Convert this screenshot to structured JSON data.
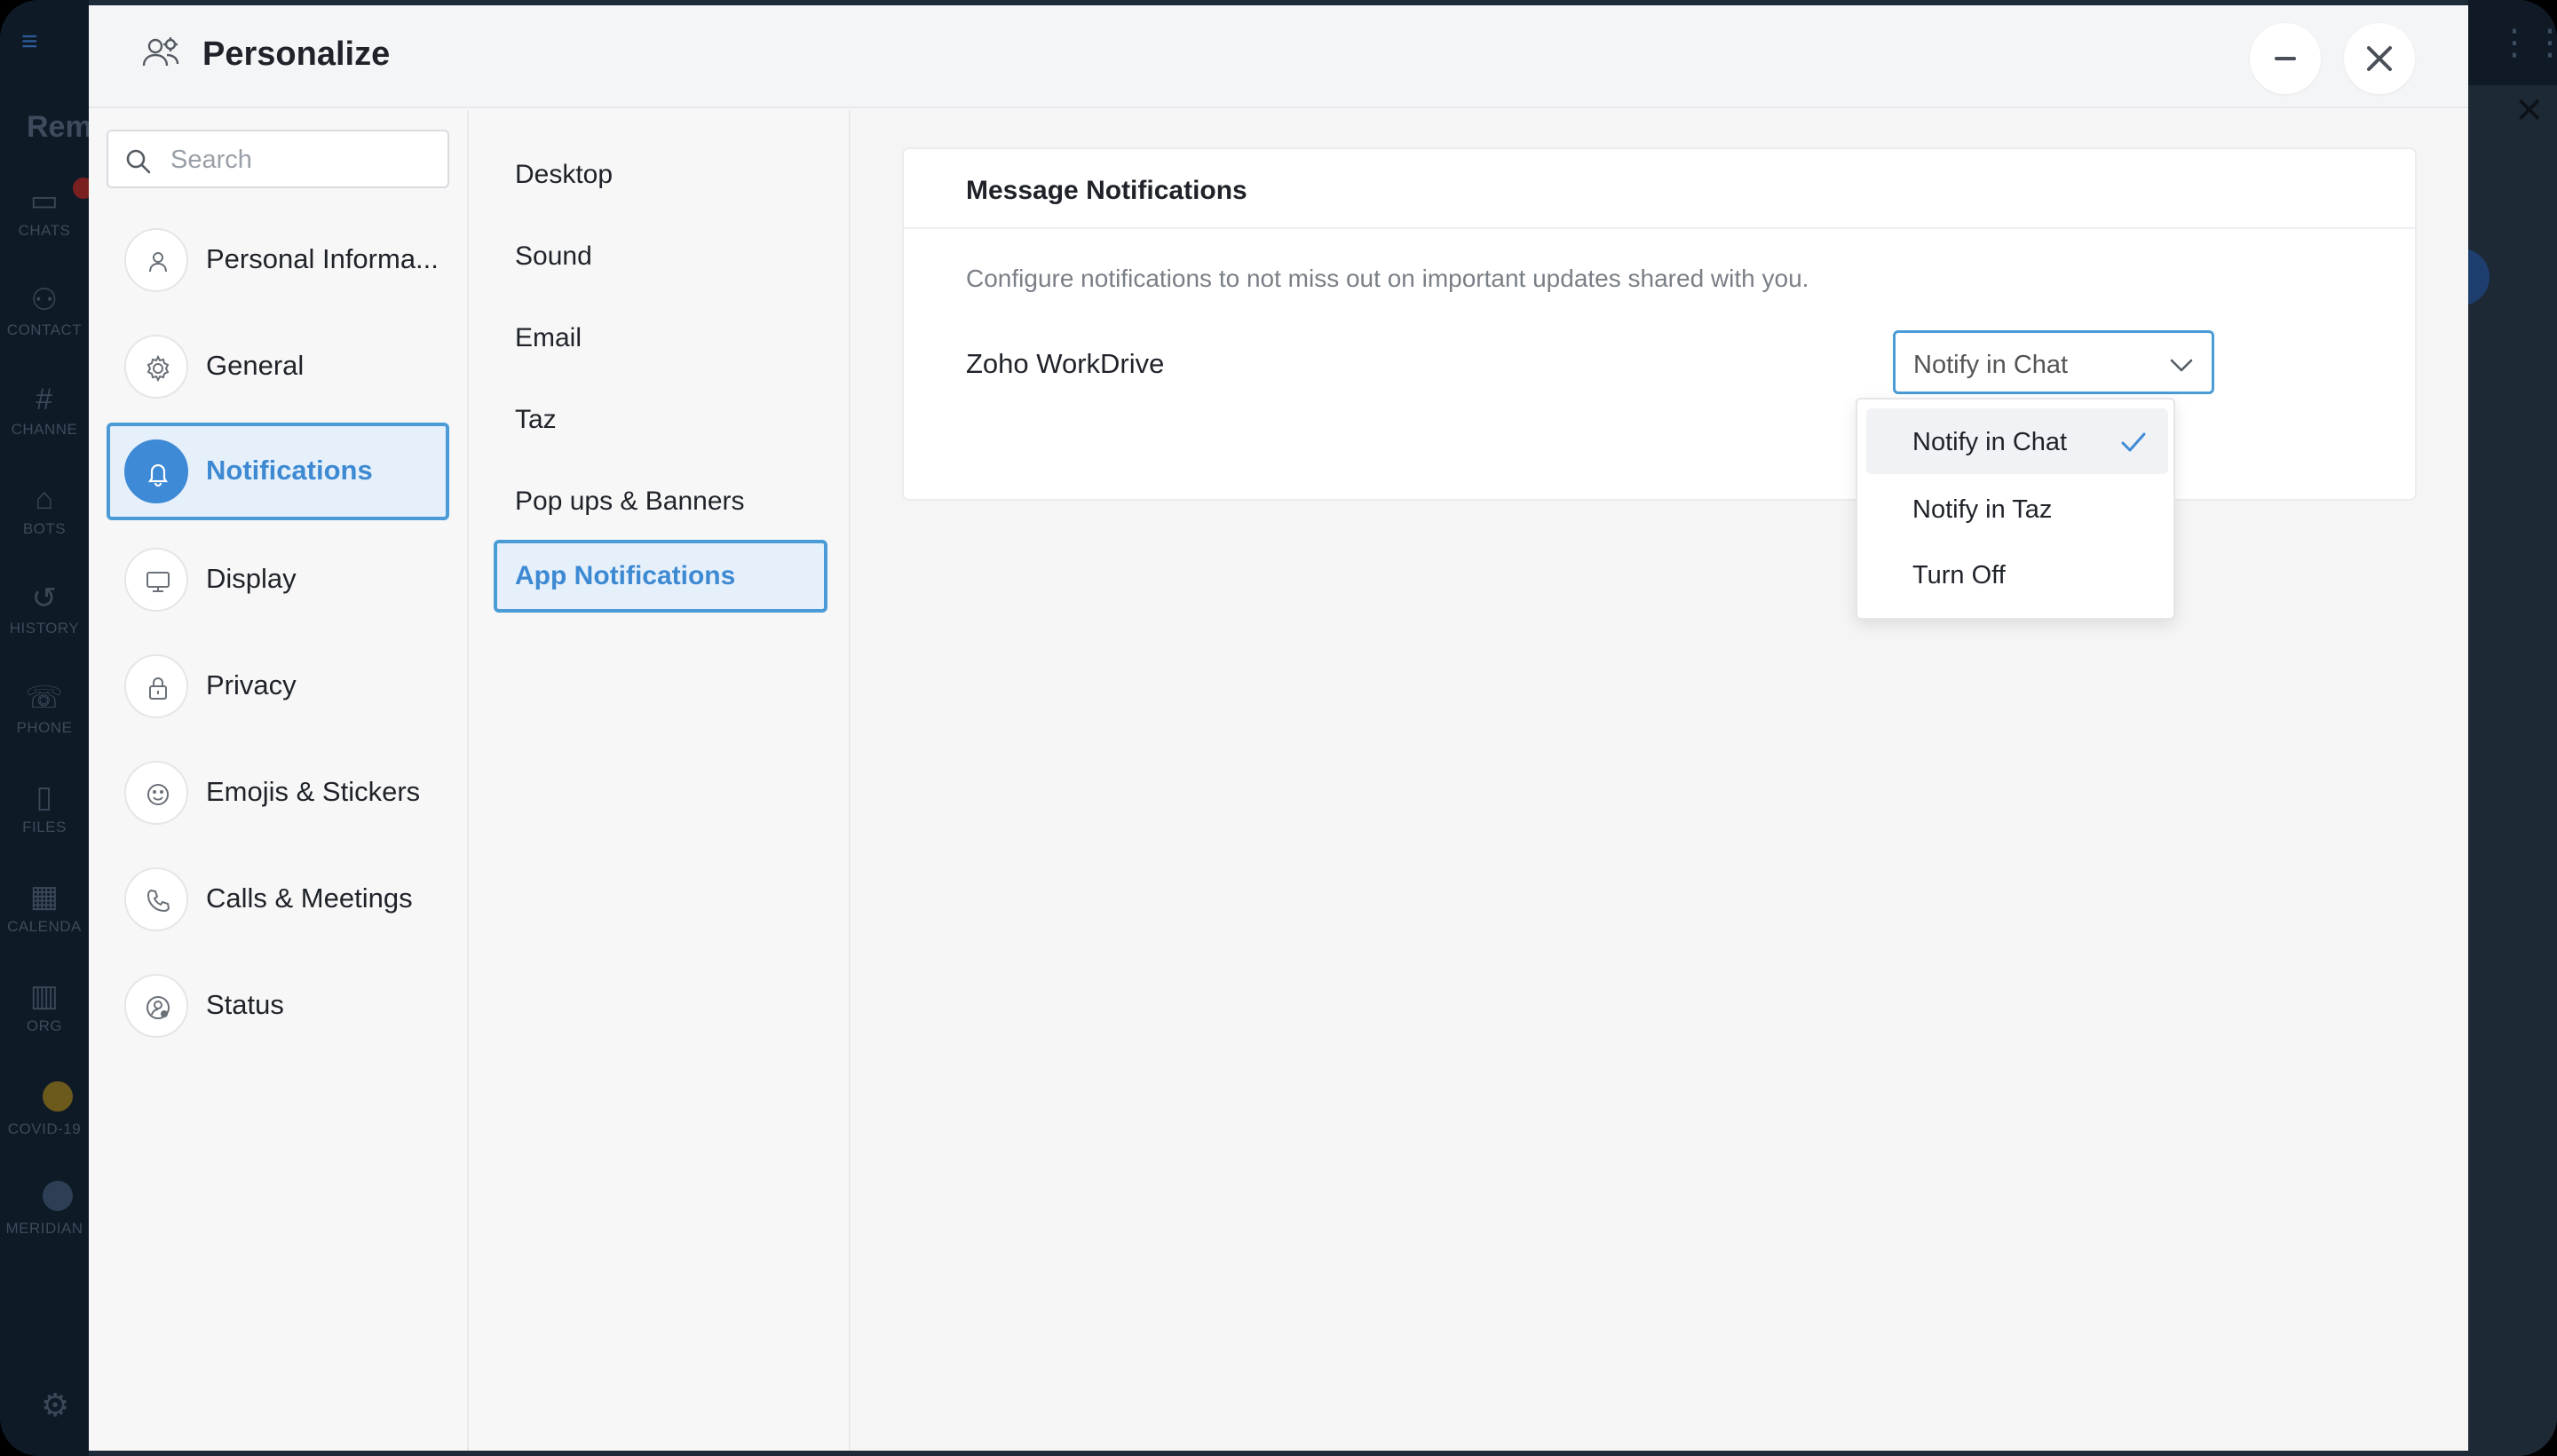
{
  "background_app": {
    "title_partial": "Rem",
    "rail_items": [
      {
        "label": "CHATS",
        "icon": "chat-icon"
      },
      {
        "label": "CONTACT",
        "icon": "contact-icon"
      },
      {
        "label": "CHANNE",
        "icon": "hash-icon"
      },
      {
        "label": "BOTS",
        "icon": "bot-icon"
      },
      {
        "label": "HISTORY",
        "icon": "history-icon"
      },
      {
        "label": "PHONE",
        "icon": "phone-icon"
      },
      {
        "label": "FILES",
        "icon": "file-icon"
      },
      {
        "label": "CALENDA",
        "icon": "calendar-icon"
      },
      {
        "label": "ORG",
        "icon": "org-icon"
      },
      {
        "label": "COVID-19",
        "icon": "covid-icon"
      },
      {
        "label": "MERIDIAN",
        "icon": "meridian-icon"
      }
    ]
  },
  "modal": {
    "title": "Personalize",
    "header_icon": "users-gear-icon",
    "minimize_icon": "minus-icon",
    "close_icon": "close-icon"
  },
  "search": {
    "placeholder": "Search",
    "icon": "search-icon"
  },
  "nav": {
    "items": [
      {
        "label": "Personal Informa...",
        "icon": "user-icon"
      },
      {
        "label": "General",
        "icon": "gear-icon"
      },
      {
        "label": "Notifications",
        "icon": "bell-icon",
        "active": true
      },
      {
        "label": "Display",
        "icon": "monitor-icon"
      },
      {
        "label": "Privacy",
        "icon": "lock-icon"
      },
      {
        "label": "Emojis & Stickers",
        "icon": "smiley-icon"
      },
      {
        "label": "Calls & Meetings",
        "icon": "phone-icon"
      },
      {
        "label": "Status",
        "icon": "status-icon"
      }
    ]
  },
  "subnav": {
    "items": [
      {
        "label": "Desktop"
      },
      {
        "label": "Sound"
      },
      {
        "label": "Email"
      },
      {
        "label": "Taz"
      },
      {
        "label": "Pop ups & Banners"
      },
      {
        "label": "App Notifications",
        "active": true
      }
    ]
  },
  "card": {
    "title": "Message Notifications",
    "description": "Configure notifications to not miss out on important updates shared with you.",
    "row_label": "Zoho WorkDrive",
    "select_value": "Notify in Chat"
  },
  "dropdown": {
    "options": [
      {
        "label": "Notify in Chat",
        "selected": true
      },
      {
        "label": "Notify in Taz"
      },
      {
        "label": "Turn Off"
      }
    ],
    "check_icon": "check-icon"
  },
  "colors": {
    "accent": "#3e8ad6",
    "active_bg": "#e6f0fb",
    "active_border": "#4a9bd6"
  }
}
